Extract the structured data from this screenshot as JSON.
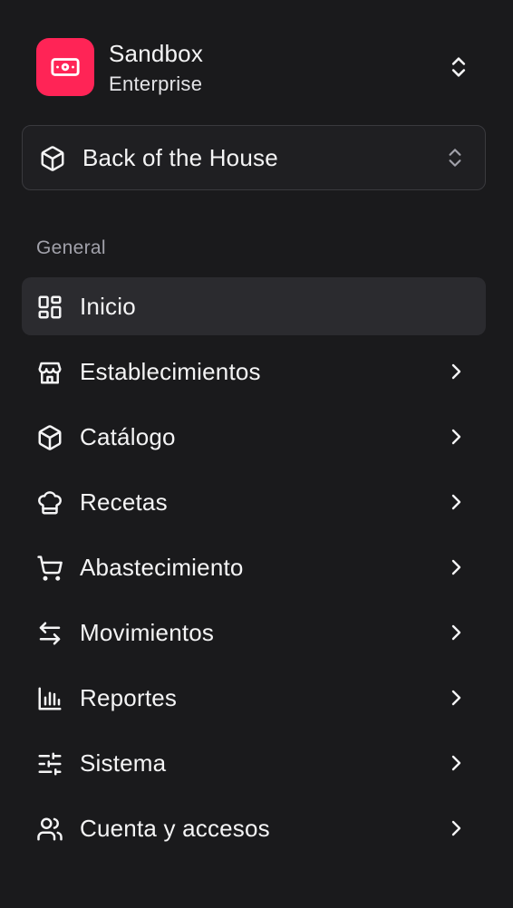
{
  "org": {
    "name": "Sandbox",
    "plan": "Enterprise",
    "logo_color": "#ff2456"
  },
  "location": {
    "label": "Back of the House",
    "icon": "box-icon"
  },
  "nav": {
    "section_label": "General",
    "items": [
      {
        "label": "Inicio",
        "icon": "dashboard-icon",
        "active": true,
        "has_submenu": false
      },
      {
        "label": "Establecimientos",
        "icon": "store-icon",
        "active": false,
        "has_submenu": true
      },
      {
        "label": "Catálogo",
        "icon": "box-icon",
        "active": false,
        "has_submenu": true
      },
      {
        "label": "Recetas",
        "icon": "chef-hat-icon",
        "active": false,
        "has_submenu": true
      },
      {
        "label": "Abastecimiento",
        "icon": "shopping-cart-icon",
        "active": false,
        "has_submenu": true
      },
      {
        "label": "Movimientos",
        "icon": "arrows-left-right-icon",
        "active": false,
        "has_submenu": true
      },
      {
        "label": "Reportes",
        "icon": "bar-chart-icon",
        "active": false,
        "has_submenu": true
      },
      {
        "label": "Sistema",
        "icon": "sliders-icon",
        "active": false,
        "has_submenu": true
      },
      {
        "label": "Cuenta y accesos",
        "icon": "users-icon",
        "active": false,
        "has_submenu": true
      }
    ]
  },
  "colors": {
    "background": "#1a1a1c",
    "active_item": "#2b2b2f",
    "accent": "#ff2456"
  }
}
